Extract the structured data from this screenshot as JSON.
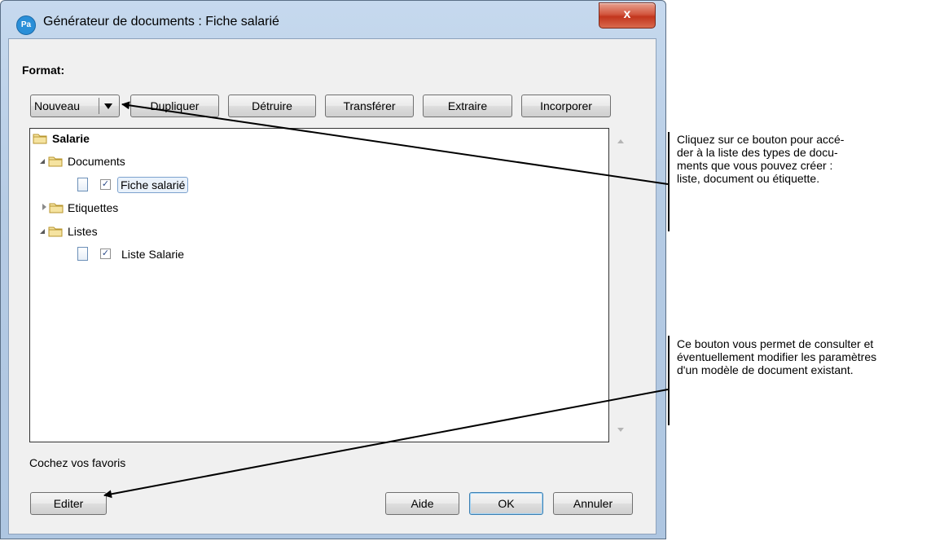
{
  "window": {
    "title": "Générateur de documents : Fiche salarié",
    "app_icon": "Pa",
    "close_glyph": "x"
  },
  "format_section": {
    "label": "Format:",
    "buttons": {
      "new": "Nouveau",
      "duplicate": "Dupliquer",
      "delete": "Détruire",
      "transfer": "Transférer",
      "extract": "Extraire",
      "incorporate": "Incorporer"
    }
  },
  "tree": {
    "root": "Salarie",
    "groups": [
      {
        "label": "Documents",
        "expanded": true,
        "items": [
          {
            "label": "Fiche salarié",
            "checked": true,
            "selected": true
          }
        ]
      },
      {
        "label": "Etiquettes",
        "expanded": false,
        "items": []
      },
      {
        "label": "Listes",
        "expanded": true,
        "items": [
          {
            "label": "Liste Salarie",
            "checked": true,
            "selected": false
          }
        ]
      }
    ]
  },
  "footer": {
    "favorites_label": "Cochez vos favoris",
    "edit_label": "Editer",
    "help_label": "Aide",
    "ok_label": "OK",
    "cancel_label": "Annuler"
  },
  "callouts": {
    "top": {
      "line1": "Cliquez sur ce bouton pour accé-",
      "line2": "der à la liste des types de docu-",
      "line3": "ments que vous pouvez créer :",
      "line4": "liste, document ou étiquette."
    },
    "bottom": {
      "line1": "Ce bouton vous permet de consulter et",
      "line2": "éventuellement modifier les paramètres",
      "line3": "d'un modèle de document existant."
    }
  },
  "colors": {
    "frame": "#b5cbe4",
    "close": "#c2351d",
    "ok_border": "#3c7fb1",
    "selection": "#eaf2fb"
  }
}
